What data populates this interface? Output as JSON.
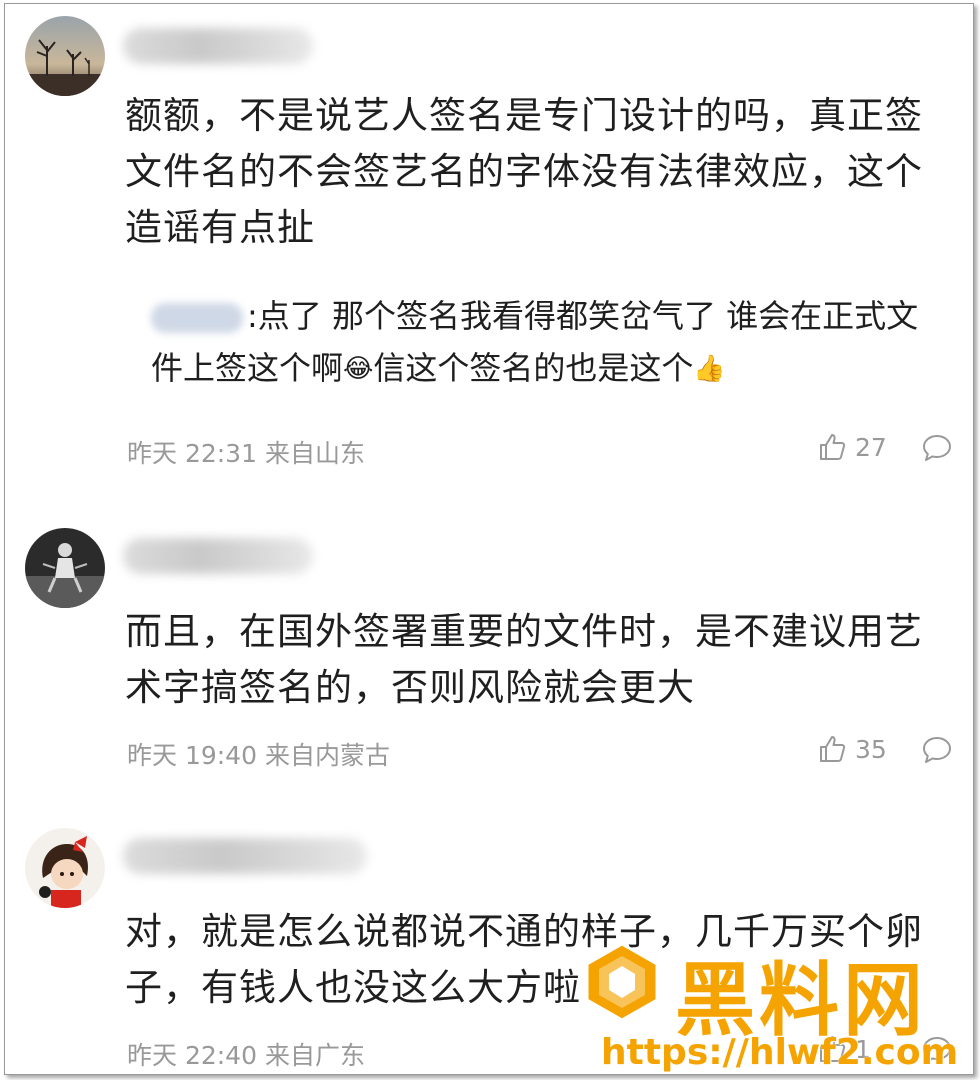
{
  "comments": [
    {
      "text": "额额，不是说艺人签名是专门设计的吗，真正签文件名的不会签艺名的字体没有法律效应，这个造谣有点扯",
      "reply": {
        "text_a": ":点了 那个签名我看得都笑岔气了 谁会在正式文件上签这个啊",
        "emoji_a": "😂",
        "text_b": "信这个签名的也是这个",
        "emoji_b": "👍"
      },
      "meta": "昨天 22:31 来自山东",
      "likes": "27"
    },
    {
      "text": "而且，在国外签署重要的文件时，是不建议用艺术字搞签名的，否则风险就会更大",
      "meta": "昨天 19:40 来自内蒙古",
      "likes": "35"
    },
    {
      "text": "对，就是怎么说都说不通的样子，几千万买个卵子，有钱人也没这么大方啦",
      "meta": "昨天 22:40 来自广东",
      "likes": "1"
    }
  ],
  "icons": {
    "like": "thumbs-up-icon",
    "reply": "speech-bubble-icon"
  },
  "watermark": {
    "title": "黑料网",
    "url": "https://hlwf2.com"
  },
  "colors": {
    "meta_gray": "#999999",
    "text": "#1f1f1f",
    "watermark": "#f5a300"
  }
}
